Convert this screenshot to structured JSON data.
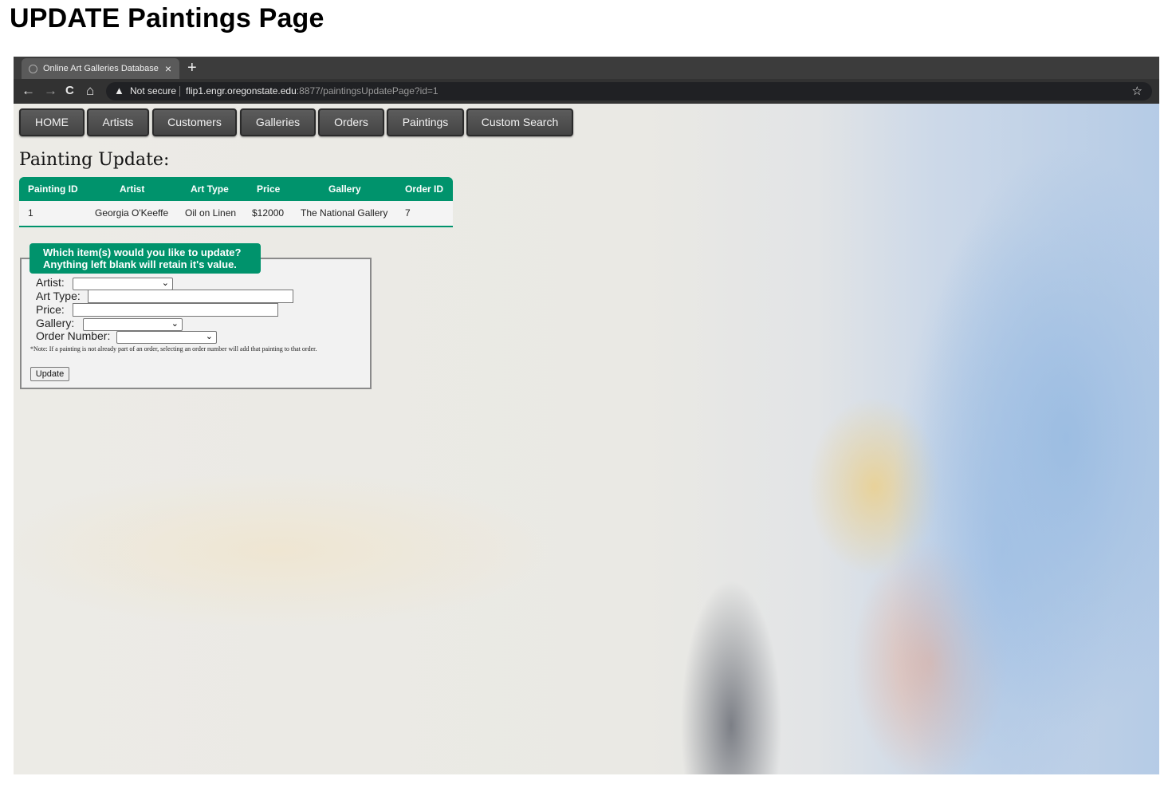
{
  "doc_heading": "UPDATE Paintings Page",
  "browser": {
    "tab_title": "Online Art Galleries Database",
    "tab_close": "×",
    "new_tab": "+",
    "security_label": "Not secure",
    "url_host": "flip1.engr.oregonstate.edu",
    "url_path": ":8877/paintingsUpdatePage?id=1",
    "back": "←",
    "forward": "→",
    "reload": "C",
    "home": "⌂",
    "warn": "▲",
    "star": "☆"
  },
  "nav": [
    "HOME",
    "Artists",
    "Customers",
    "Galleries",
    "Orders",
    "Paintings",
    "Custom Search"
  ],
  "page_title": "Painting Update:",
  "table": {
    "headers": [
      "Painting ID",
      "Artist",
      "Art Type",
      "Price",
      "Gallery",
      "Order ID"
    ],
    "row": [
      "1",
      "Georgia O'Keeffe",
      "Oil on Linen",
      "$12000",
      "The National Gallery",
      "7"
    ]
  },
  "form": {
    "legend_line1": "Which item(s) would you like to update?",
    "legend_line2": "Anything left blank will retain it's value.",
    "artist_label": "Artist:",
    "art_type_label": "Art Type:",
    "price_label": "Price:",
    "gallery_label": "Gallery:",
    "order_label": "Order Number:",
    "note": "*Note: If a painting is not already part of an order, selecting an order number will add that painting to that order.",
    "submit_label": "Update",
    "chevron": "⌄"
  }
}
